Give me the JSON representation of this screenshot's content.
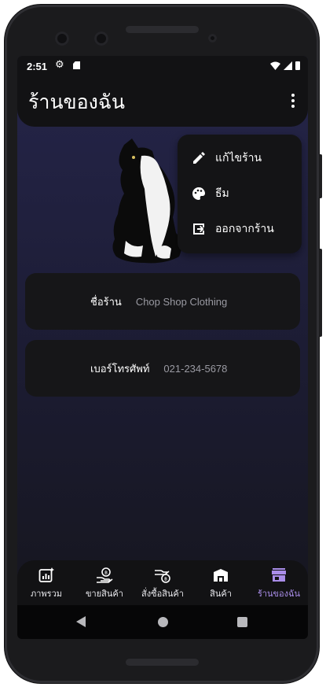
{
  "status_bar": {
    "time": "2:51"
  },
  "app_bar": {
    "title": "ร้านของฉัน"
  },
  "shop_fields": [
    {
      "label": "ชื่อร้าน",
      "value": "Chop Shop Clothing"
    },
    {
      "label": "เบอร์โทรศัพท์",
      "value": "021-234-5678"
    }
  ],
  "overflow_menu": {
    "items": [
      {
        "label": "แก้ไขร้าน",
        "icon": "pencil-icon"
      },
      {
        "label": "ธีม",
        "icon": "palette-icon"
      },
      {
        "label": "ออกจากร้าน",
        "icon": "exit-icon"
      }
    ]
  },
  "bottom_nav": {
    "items": [
      {
        "label": "ภาพรวม",
        "icon": "overview-chart-icon",
        "active": false
      },
      {
        "label": "ขายสินค้า",
        "icon": "sell-hand-coin-icon",
        "active": false
      },
      {
        "label": "สั่งซื้อสินค้า",
        "icon": "order-hand-coin-icon",
        "active": false
      },
      {
        "label": "สินค้า",
        "icon": "warehouse-icon",
        "active": false
      },
      {
        "label": "ร้านของฉัน",
        "icon": "store-icon",
        "active": true
      }
    ],
    "active_color": "#a98de8"
  },
  "colors": {
    "screen_top": "#25254a",
    "screen_bottom": "#15151c",
    "card": "#161618",
    "bar": "#121214"
  }
}
